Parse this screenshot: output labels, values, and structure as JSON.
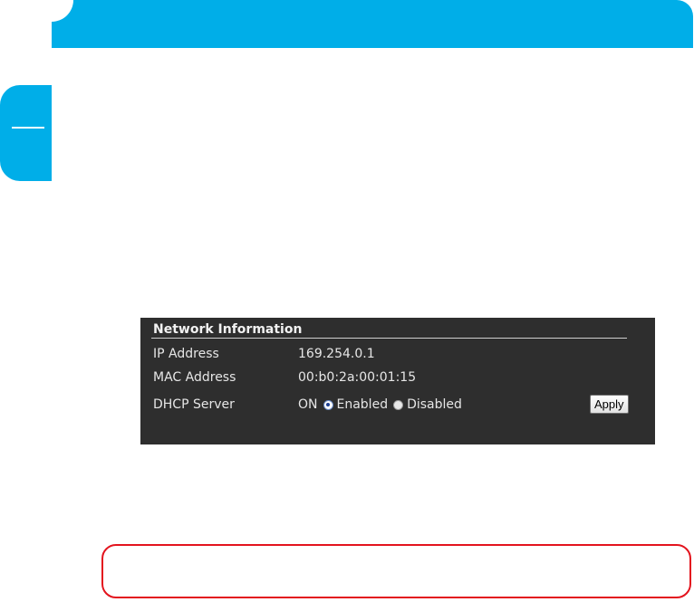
{
  "colors": {
    "brand_blue": "#00aee8",
    "panel_bg": "#2e2e2e",
    "callout_red": "#e3141e"
  },
  "network_info": {
    "title": "Network Information",
    "ip_label": "IP Address",
    "ip_value": "169.254.0.1",
    "mac_label": "MAC Address",
    "mac_value": "00:b0:2a:00:01:15",
    "dhcp_label": "DHCP Server",
    "dhcp_status": "ON",
    "options": {
      "enabled_label": "Enabled",
      "disabled_label": "Disabled",
      "selected": "Enabled"
    },
    "apply_label": "Apply"
  }
}
